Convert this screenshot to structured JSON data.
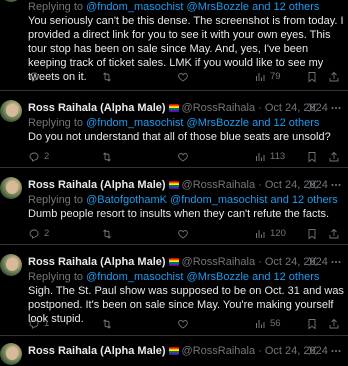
{
  "tweets": [
    {
      "partial_top": true,
      "reply_prefix": "Replying to ",
      "reply_handles": "@fndom_masochist @MrsBozzle and 12 others",
      "text": "You seriously can't be this dense. The screenshot is from today. I provided a direct link for you to see it with your own eyes. This tour stop has been on sale since May. And, yes, I've been keeping track of ticket sales. LMK if you would like to see my tweets on it.",
      "replies": "",
      "retweets": "",
      "likes": "",
      "views": "79"
    },
    {
      "name": "Ross Raihala (Alpha Male)",
      "handle": "@RossRaihala",
      "dot": "·",
      "date": "Oct 24, 2024",
      "reply_prefix": "Replying to ",
      "reply_handles": "@fndom_masochist @MrsBozzle and 12 others",
      "text": "Do you not understand that all of those blue seats are unsold?",
      "replies": "2",
      "retweets": "",
      "likes": "",
      "views": "113"
    },
    {
      "name": "Ross Raihala (Alpha Male)",
      "handle": "@RossRaihala",
      "dot": "·",
      "date": "Oct 24, 2024",
      "reply_prefix": "Replying to ",
      "reply_handles": "@BatofgothamK @fndom_masochist and 12 others",
      "text": "Dumb people resort to insults when they can't refute the facts.",
      "replies": "2",
      "retweets": "",
      "likes": "",
      "views": "120"
    },
    {
      "name": "Ross Raihala (Alpha Male)",
      "handle": "@RossRaihala",
      "dot": "·",
      "date": "Oct 24, 2024",
      "reply_prefix": "Replying to ",
      "reply_handles": "@fndom_masochist @MrsBozzle and 12 others",
      "text": "Sigh. The St. Paul show was supposed to be on Oct. 31 and was postponed. It's been on sale since May. You're making yourself look stupid.",
      "replies": "1",
      "retweets": "",
      "likes": "",
      "views": "56"
    },
    {
      "name": "Ross Raihala (Alpha Male)",
      "handle": "@RossRaihala",
      "dot": "·",
      "date": "Oct 24, 2024"
    }
  ]
}
